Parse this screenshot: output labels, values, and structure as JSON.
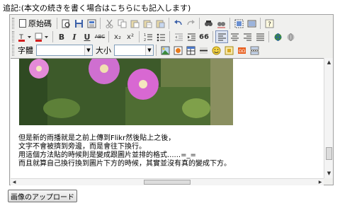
{
  "header": {
    "text": "追記:(本文の続きを書く場合はこちらにも記入します)"
  },
  "toolbar1": {
    "source_label": "原始碼",
    "buttons": [
      "preview-icon",
      "save-icon",
      "template-icon",
      "cut-icon",
      "copy-icon",
      "paste-icon",
      "paste-text-icon",
      "paste-word-icon",
      "undo-icon",
      "redo-icon",
      "find-icon",
      "replace-icon",
      "select-all-icon",
      "remove-format-icon",
      "help-icon"
    ]
  },
  "toolbar2": {
    "buttons": [
      "text-color-icon",
      "bg-color-icon",
      "bold-icon",
      "italic-icon",
      "underline-icon",
      "strikethrough-icon",
      "subscript-icon",
      "superscript-icon",
      "numbered-list-icon",
      "bulleted-list-icon",
      "outdent-icon",
      "indent-icon",
      "blockquote-icon",
      "align-left-icon",
      "align-center-icon",
      "align-right-icon",
      "justify-icon",
      "link-icon",
      "unlink-icon"
    ],
    "bold_label": "B",
    "italic_label": "I",
    "underline_label": "U",
    "strike_label": "ABC",
    "sub_label": "x₂",
    "sup_label": "x²",
    "quote_label": "66"
  },
  "toolbar3": {
    "font_label": "字體",
    "font_value": "",
    "size_label": "大小",
    "size_value": ""
  },
  "content": {
    "lines": [
      "但是新的雨播就是之前上傳到Flikr然後貼上之後，",
      "文字不會被擠到旁邊，而是會往下換行。",
      "用這個方法貼的時候則是變成跟圖片並排的格式......=_=",
      "而且就算自己換行換到圖片下方的時候，其實並沒有真的變成下方。"
    ]
  },
  "upload_button": {
    "label": "画像のアップロード"
  },
  "colors": {
    "toolbar_bg": "#f0f0ee",
    "active_border": "#7a8fb8",
    "text_color_red": "#d21f1f"
  }
}
